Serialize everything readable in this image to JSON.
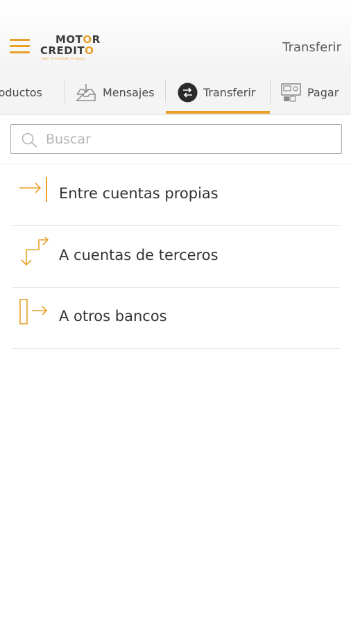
{
  "app": {
    "logo_line1_a": "MOT",
    "logo_line1_b": "O",
    "logo_line1_c": "R",
    "logo_line2_a": "CREDIT",
    "logo_line2_b": "O",
    "logo_tagline": "fácil, te entiende, te apoya",
    "header_title": "Transferir",
    "menu_icon": "hamburger-menu-icon"
  },
  "tabs": [
    {
      "label": "Productos",
      "icon": "products-icon",
      "active": false
    },
    {
      "label": "Mensajes",
      "icon": "inbox-icon",
      "active": false
    },
    {
      "label": "Transferir",
      "icon": "transfer-circle-icon",
      "active": true
    },
    {
      "label": "Pagar",
      "icon": "pay-icon",
      "active": false
    }
  ],
  "search": {
    "placeholder": "Buscar",
    "value": "",
    "icon": "search-icon"
  },
  "options": [
    {
      "label": "Entre cuentas propias",
      "icon": "arrow-to-bar-icon"
    },
    {
      "label": "A cuentas de terceros",
      "icon": "corner-arrows-icon"
    },
    {
      "label": "A otros bancos",
      "icon": "bar-arrow-right-icon"
    }
  ],
  "colors": {
    "accent": "#e8a029",
    "text": "#333333",
    "header_bg": "#f4f4f4"
  }
}
